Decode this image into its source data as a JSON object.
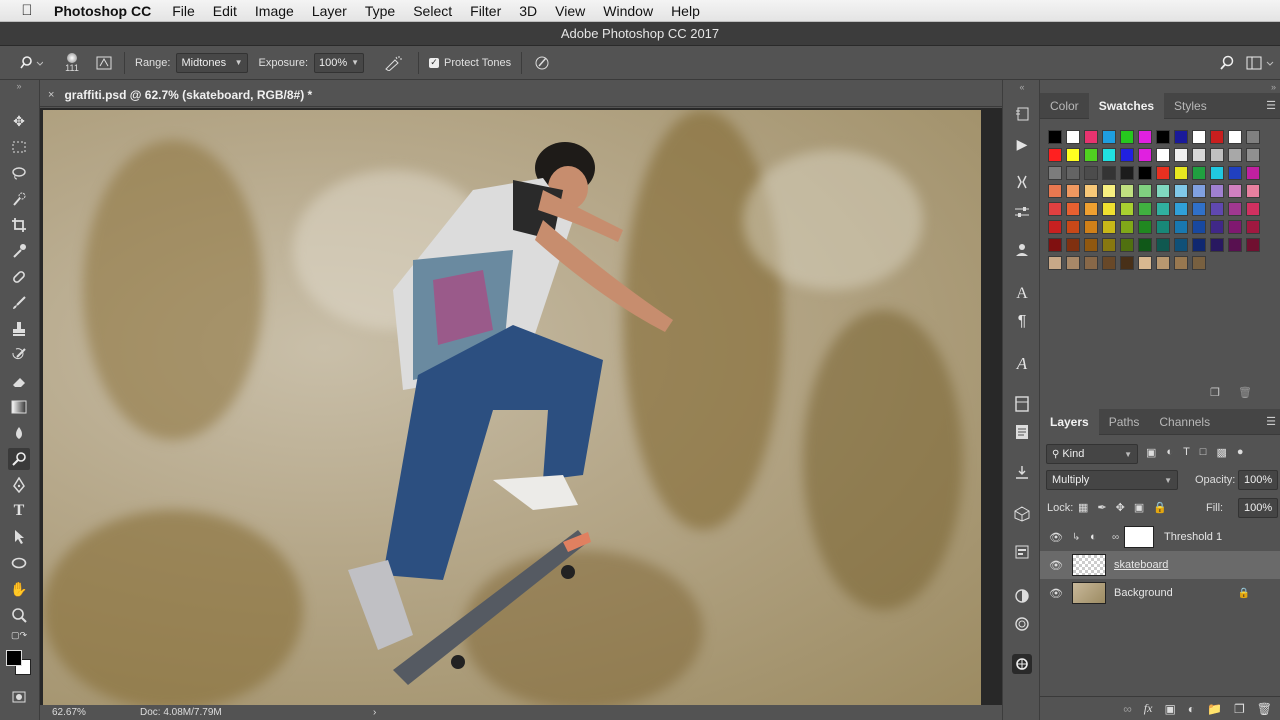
{
  "menubar": {
    "apple_icon": "apple-logo-icon",
    "app_name": "Photoshop CC",
    "items": [
      "File",
      "Edit",
      "Image",
      "Layer",
      "Type",
      "Select",
      "Filter",
      "3D",
      "View",
      "Window",
      "Help"
    ]
  },
  "window": {
    "title": "Adobe Photoshop CC 2017"
  },
  "options": {
    "brush_size": "111",
    "range_label": "Range:",
    "range_value": "Midtones",
    "exposure_label": "Exposure:",
    "exposure_value": "100%",
    "protect_tones_label": "Protect Tones",
    "protect_tones_checked": true
  },
  "document": {
    "tab_title": "graffiti.psd @ 62.7% (skateboard, RGB/8#) *",
    "close_glyph": "×"
  },
  "status": {
    "zoom": "62.67%",
    "doc_size": "Doc: 4.08M/7.79M",
    "arrow": "›"
  },
  "color_panel": {
    "tabs": [
      "Color",
      "Swatches",
      "Styles"
    ],
    "active_tab": "Swatches"
  },
  "layers_panel": {
    "tabs": [
      "Layers",
      "Paths",
      "Channels"
    ],
    "active_tab": "Layers",
    "filter_kind": "Kind",
    "blend_mode": "Multiply",
    "opacity_label": "Opacity:",
    "opacity_value": "100%",
    "lock_label": "Lock:",
    "fill_label": "Fill:",
    "fill_value": "100%",
    "layers": [
      {
        "name": "Threshold 1",
        "visible": true,
        "type": "adjustment"
      },
      {
        "name": "skateboard",
        "visible": true,
        "type": "pixel",
        "selected": true
      },
      {
        "name": "Background",
        "visible": true,
        "type": "background",
        "locked": true
      }
    ]
  },
  "colors": {
    "ui_bg": "#535353",
    "panel_tab_bg": "#454545",
    "selected_layer": "#6a6a6a"
  },
  "swatch_colors": [
    "#000000",
    "#ffffff",
    "#e8336f",
    "#1e9ee0",
    "#26c81e",
    "#e020e0",
    "#000000",
    "#1a1a9a",
    "#ffffff",
    "#c81e1e",
    "#ffffff",
    "#808080",
    "#ff2020",
    "#ffff20",
    "#50d020",
    "#20e0e0",
    "#2020e0",
    "#e020e0",
    "#ffffff",
    "#f0f0f0",
    "#d8d8d8",
    "#c0c0c0",
    "#a8a8a8",
    "#909090",
    "#7c7c7c",
    "#646464",
    "#4c4c4c",
    "#343434",
    "#1c1c1c",
    "#000000",
    "#e83020",
    "#e8e820",
    "#20a040",
    "#20c8e0",
    "#2040c0",
    "#c020a0",
    "#e87850",
    "#f09860",
    "#f8c878",
    "#f8f080",
    "#c0e080",
    "#80d080",
    "#80d8c0",
    "#80c8e8",
    "#80a0e0",
    "#a080d0",
    "#d080c0",
    "#e880a0",
    "#e04040",
    "#e86030",
    "#f0a030",
    "#f0e030",
    "#a8d030",
    "#40b040",
    "#30b0a0",
    "#30a0d8",
    "#3070c8",
    "#6048b0",
    "#a03890",
    "#d03060",
    "#c82020",
    "#c84818",
    "#d08018",
    "#c8b818",
    "#80a818",
    "#208820",
    "#188878",
    "#1878b0",
    "#1848a0",
    "#402888",
    "#801870",
    "#a01840",
    "#801010",
    "#803010",
    "#905810",
    "#887810",
    "#507010",
    "#105818",
    "#105850",
    "#105078",
    "#102870",
    "#281860",
    "#581050",
    "#701030",
    "#c8a888",
    "#a88868",
    "#886848",
    "#684828",
    "#483018",
    "#d8b890",
    "#b89870",
    "#987850",
    "#786040"
  ]
}
